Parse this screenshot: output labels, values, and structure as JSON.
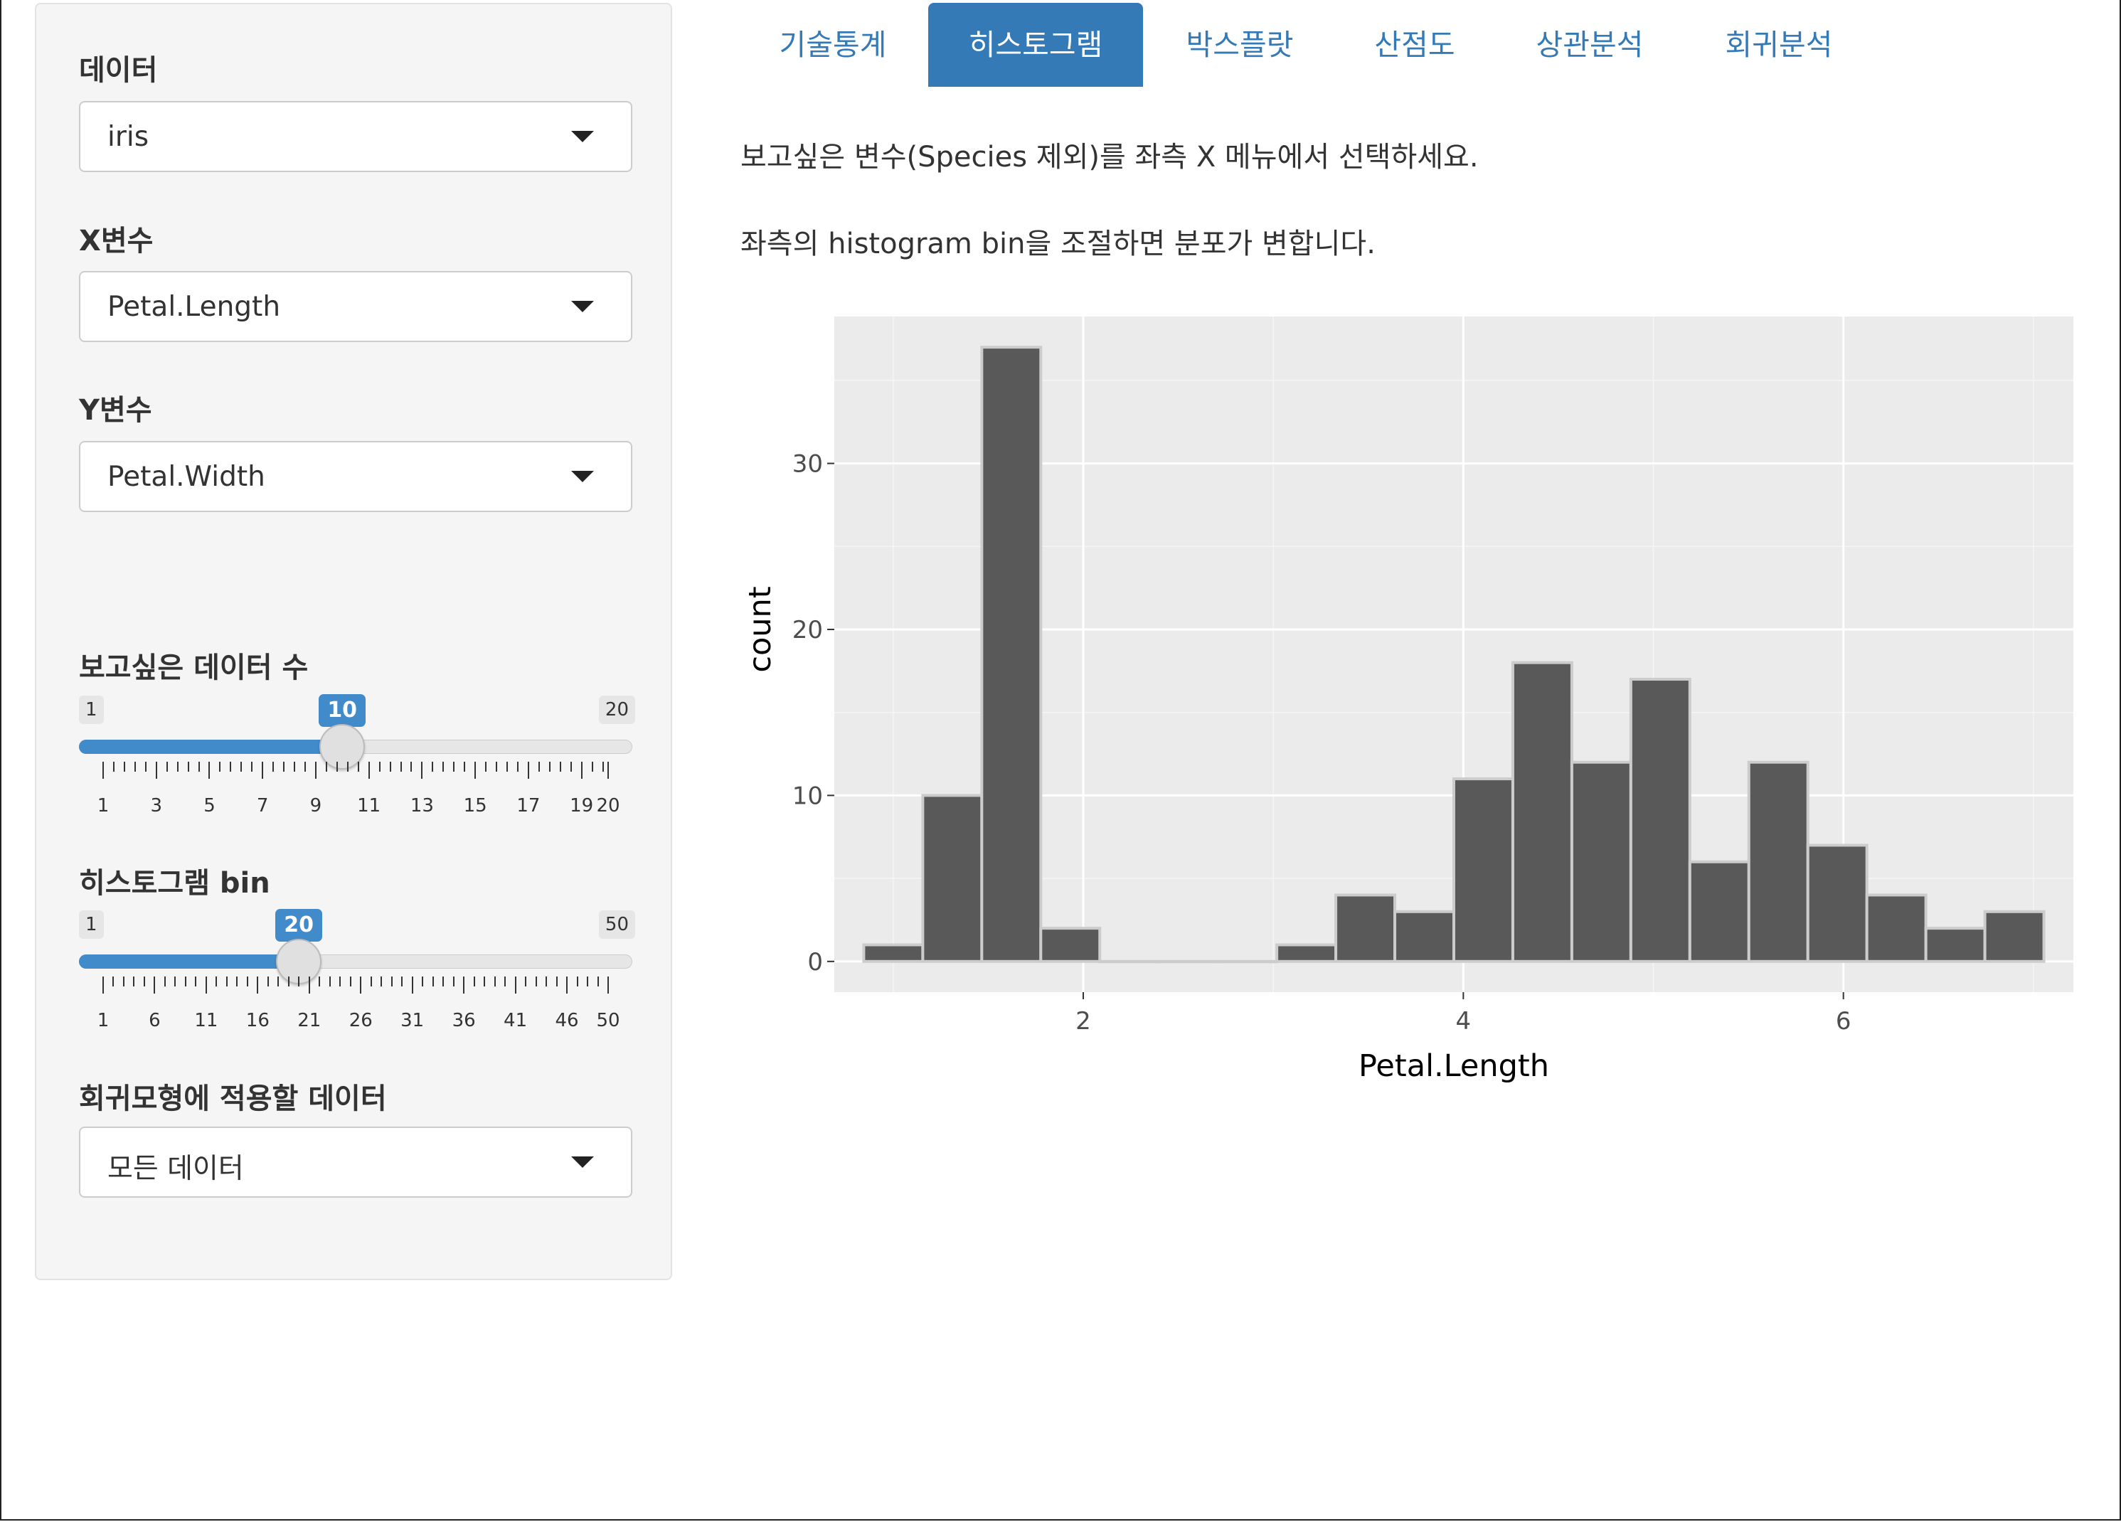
{
  "sidebar": {
    "data_label": "데이터",
    "data_value": "iris",
    "x_label": "X변수",
    "x_value": "Petal.Length",
    "y_label": "Y변수",
    "y_value": "Petal.Width",
    "n_label": "보고싶은 데이터 수",
    "n_slider": {
      "min": 1,
      "max": 20,
      "value": 10,
      "ticks": [
        "1",
        "3",
        "5",
        "7",
        "9",
        "11",
        "13",
        "15",
        "17",
        "19",
        "20"
      ],
      "tick_values": [
        1,
        3,
        5,
        7,
        9,
        11,
        13,
        15,
        17,
        19,
        20
      ]
    },
    "bin_label": "히스토그램 bin",
    "bin_slider": {
      "min": 1,
      "max": 50,
      "value": 20,
      "ticks": [
        "1",
        "6",
        "11",
        "16",
        "21",
        "26",
        "31",
        "36",
        "41",
        "46",
        "50"
      ],
      "tick_values": [
        1,
        6,
        11,
        16,
        21,
        26,
        31,
        36,
        41,
        46,
        50
      ]
    },
    "reg_label": "회귀모형에 적용할 데이터",
    "reg_value": "모든 데이터"
  },
  "tabs": [
    {
      "label": "기술통계",
      "active": false
    },
    {
      "label": "히스토그램",
      "active": true
    },
    {
      "label": "박스플랏",
      "active": false
    },
    {
      "label": "산점도",
      "active": false
    },
    {
      "label": "상관분석",
      "active": false
    },
    {
      "label": "회귀분석",
      "active": false
    }
  ],
  "main": {
    "para1": "보고싶은 변수(Species 제외)를 좌측 X 메뉴에서 선택하세요.",
    "para2": "좌측의 histogram bin을 조절하면 분포가 변합니다."
  },
  "colors": {
    "accent": "#428bca",
    "tab_active": "#337ab7",
    "panel_bg": "#ebebeb",
    "bar_fill": "#595959",
    "bar_outline": "#cccccc"
  },
  "chart_data": {
    "type": "bar",
    "subtype": "histogram",
    "xlabel": "Petal.Length",
    "ylabel": "count",
    "xlim": [
      0.69,
      7.21
    ],
    "ylim": [
      -1.85,
      38.85
    ],
    "xticks": [
      2,
      4,
      6
    ],
    "yticks": [
      0,
      10,
      20,
      30
    ],
    "grid": true,
    "bin_width": 0.3105,
    "bin_start": 0.845,
    "counts": [
      1,
      10,
      37,
      2,
      0,
      0,
      0,
      1,
      4,
      3,
      11,
      18,
      12,
      17,
      6,
      12,
      7,
      4,
      2,
      3
    ]
  }
}
